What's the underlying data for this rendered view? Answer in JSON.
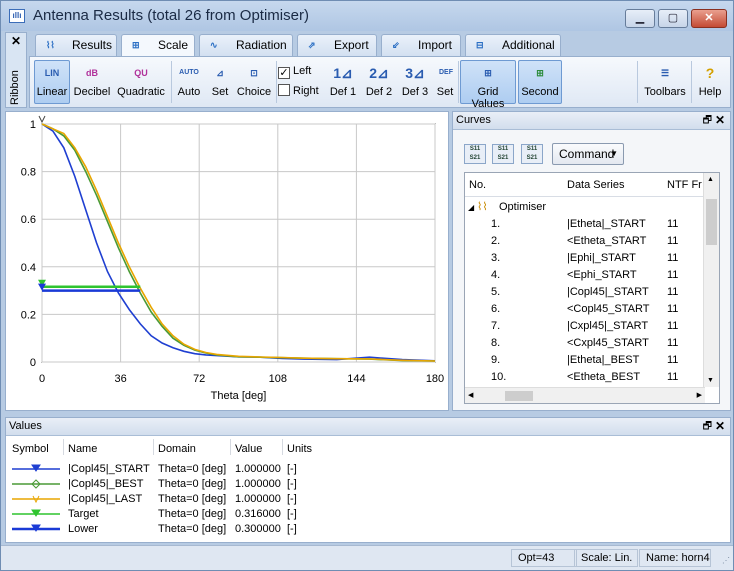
{
  "window": {
    "title": "Antenna Results (total 26 from Optimiser)",
    "minimize": "▁",
    "maximize": "▢",
    "close": "✕"
  },
  "ribbon": {
    "label": "Ribbon",
    "close": "✕"
  },
  "tabs": [
    {
      "label": "Results",
      "icon": "chart-icon"
    },
    {
      "label": "Scale",
      "icon": "scale-icon"
    },
    {
      "label": "Radiation",
      "icon": "radiation-icon"
    },
    {
      "label": "Export",
      "icon": "export-icon"
    },
    {
      "label": "Import",
      "icon": "import-icon"
    },
    {
      "label": "Additional",
      "icon": "additional-icon"
    }
  ],
  "toolbar": {
    "linear": "Linear",
    "decibel": "Decibel",
    "quadratic": "Quadratic",
    "auto": "Auto",
    "set": "Set",
    "choice": "Choice",
    "left": "Left",
    "right": "Right",
    "def1": "Def 1",
    "def2": "Def 2",
    "def3": "Def 3",
    "set2": "Set",
    "grid_values": "Grid Values",
    "second": "Second",
    "toolbars": "Toolbars",
    "help": "Help",
    "icon_lin": "LIN",
    "icon_db": "dB",
    "icon_qu": "QU",
    "icon_auto": "AUTO",
    "icon_def": "DEF",
    "left_checked": "✓",
    "right_checked": ""
  },
  "curves_panel": {
    "title": "Curves",
    "command": "Command",
    "columns": [
      "No.",
      "Data Series",
      "NTF Fr"
    ],
    "group": "Optimiser",
    "rows": [
      {
        "no": "1.",
        "series": "|Etheta|_START",
        "ntf": "11"
      },
      {
        "no": "2.",
        "series": "<Etheta_START",
        "ntf": "11"
      },
      {
        "no": "3.",
        "series": "|Ephi|_START",
        "ntf": "11"
      },
      {
        "no": "4.",
        "series": "<Ephi_START",
        "ntf": "11"
      },
      {
        "no": "5.",
        "series": "|Copl45|_START",
        "ntf": "11"
      },
      {
        "no": "6.",
        "series": "<Copl45_START",
        "ntf": "11"
      },
      {
        "no": "7.",
        "series": "|Cxpl45|_START",
        "ntf": "11"
      },
      {
        "no": "8.",
        "series": "<Cxpl45_START",
        "ntf": "11"
      },
      {
        "no": "9.",
        "series": "|Etheta|_BEST",
        "ntf": "11"
      },
      {
        "no": "10.",
        "series": "<Etheta_BEST",
        "ntf": "11"
      }
    ],
    "tool1": "S11 S21",
    "tool2": "S11 S21",
    "tool3": "S11 S21"
  },
  "values_panel": {
    "title": "Values",
    "columns": [
      "Symbol",
      "Name",
      "Domain",
      "Value",
      "Units"
    ],
    "rows": [
      {
        "name": "|Copl45|_START",
        "domain": "Theta=0 [deg]",
        "value": "1.000000",
        "units": "[-]",
        "color": "#1f3fd1",
        "marker": "triangle-down"
      },
      {
        "name": "|Copl45|_BEST",
        "domain": "Theta=0 [deg]",
        "value": "1.000000",
        "units": "[-]",
        "color": "#4a9a36",
        "marker": "diamond"
      },
      {
        "name": "|Copl45|_LAST",
        "domain": "Theta=0 [deg]",
        "value": "1.000000",
        "units": "[-]",
        "color": "#e8a600",
        "marker": "v"
      },
      {
        "name": "Target",
        "domain": "Theta=0 [deg]",
        "value": "0.316000",
        "units": "[-]",
        "color": "#2fc42f",
        "marker": "triangle-down"
      },
      {
        "name": "Lower",
        "domain": "Theta=0 [deg]",
        "value": "0.300000",
        "units": "[-]",
        "color": "#1a3ad6",
        "marker": "triangle-down"
      }
    ]
  },
  "status": {
    "opt": "Opt=43",
    "scale": "Scale: Lin.",
    "name": "Name: horn4"
  },
  "chart_data": {
    "type": "line",
    "xlabel": "Theta [deg]",
    "ylabel": "",
    "xlim": [
      0,
      180
    ],
    "ylim": [
      0,
      1
    ],
    "xticks": [
      "0",
      "36",
      "72",
      "108",
      "144",
      "180"
    ],
    "yticks": [
      "0",
      "0.2",
      "0.4",
      "0.6",
      "0.8",
      "1"
    ],
    "grid": true,
    "series": [
      {
        "name": "|Copl45|_START",
        "color": "#1f3fd1",
        "x": [
          0,
          5,
          10,
          15,
          20,
          25,
          30,
          35,
          40,
          45,
          50,
          55,
          60,
          65,
          70,
          75,
          80,
          90,
          100,
          110,
          120,
          135,
          150,
          165,
          180
        ],
        "y": [
          1.0,
          0.97,
          0.9,
          0.78,
          0.64,
          0.5,
          0.38,
          0.29,
          0.22,
          0.16,
          0.11,
          0.08,
          0.06,
          0.045,
          0.035,
          0.03,
          0.027,
          0.022,
          0.02,
          0.015,
          0.012,
          0.01,
          0.02,
          0.01,
          0.005
        ]
      },
      {
        "name": "|Copl45|_BEST",
        "color": "#4a9a36",
        "x": [
          0,
          5,
          10,
          15,
          20,
          25,
          30,
          35,
          40,
          45,
          50,
          55,
          60,
          65,
          70,
          75,
          80,
          90,
          100,
          110,
          120,
          135,
          150,
          165,
          180
        ],
        "y": [
          1.0,
          0.98,
          0.95,
          0.89,
          0.8,
          0.7,
          0.59,
          0.48,
          0.38,
          0.29,
          0.21,
          0.15,
          0.1,
          0.07,
          0.05,
          0.038,
          0.03,
          0.022,
          0.02,
          0.018,
          0.016,
          0.014,
          0.012,
          0.006,
          0.004
        ]
      },
      {
        "name": "|Copl45|_LAST",
        "color": "#e8a600",
        "x": [
          0,
          5,
          10,
          15,
          20,
          25,
          30,
          35,
          40,
          45,
          50,
          55,
          60,
          65,
          70,
          75,
          80,
          90,
          100,
          110,
          120,
          135,
          150,
          165,
          180
        ],
        "y": [
          1.0,
          0.98,
          0.96,
          0.9,
          0.82,
          0.72,
          0.61,
          0.5,
          0.4,
          0.31,
          0.23,
          0.16,
          0.11,
          0.075,
          0.053,
          0.04,
          0.032,
          0.024,
          0.021,
          0.019,
          0.016,
          0.014,
          0.013,
          0.007,
          0.004
        ]
      },
      {
        "name": "Target",
        "color": "#2fc42f",
        "x": [
          0,
          45
        ],
        "y": [
          0.316,
          0.316
        ]
      },
      {
        "name": "Lower",
        "color": "#1a3ad6",
        "x": [
          0,
          45
        ],
        "y": [
          0.3,
          0.3
        ]
      }
    ]
  }
}
